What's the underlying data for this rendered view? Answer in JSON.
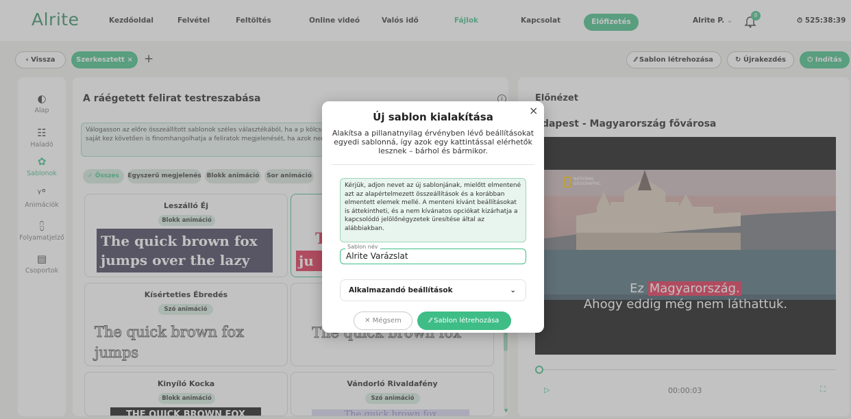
{
  "nav": {
    "logo": "Alrite",
    "items": [
      "Kezdőoldal",
      "Felvétel",
      "Feltöltés",
      "Online videó",
      "Valós idő",
      "Fájlok",
      "Kapcsolat"
    ],
    "subscribe": "Előfizetés",
    "user": "Alrite P.",
    "notifications": "8",
    "timer": "525:38:39"
  },
  "toolbar": {
    "back": "Vissza",
    "edited": "Szerkesztett",
    "create_template": "Sablon létrehozása",
    "restart": "Újrakezdés",
    "start": "Indítás"
  },
  "sidebar": [
    {
      "label": "Alap",
      "icon": "palette-icon"
    },
    {
      "label": "Haladó",
      "icon": "sliders-icon"
    },
    {
      "label": "Sablonok",
      "icon": "template-icon"
    },
    {
      "label": "Animációk",
      "icon": "motion-icon"
    },
    {
      "label": "Folyamatjelző",
      "icon": "progress-icon"
    },
    {
      "label": "Csoportok",
      "icon": "group-icon"
    }
  ],
  "main": {
    "title": "A ráégetett felirat testreszabása",
    "description": "Válogasson az előre összeállított sablonok széles választékából, ha a p kölcsönözni a feliratainak anélkül, hogy az egyes beállításokat saját kez követően is finomhangolhatja a feliratok megjelenését, ha azok nem fel",
    "filters": [
      "Összes",
      "Egyszerű megjelenés",
      "Blokk animáció",
      "Sor animáció"
    ],
    "cards": [
      {
        "title": "Leszálló Éj",
        "badge": "Blokk animáció",
        "sample": "The quick brown fox jumps over the lazy dog"
      },
      {
        "title": "Kísérteties Ébredés",
        "badge": "Szó animáció",
        "sample": "The quick brown fox jumps"
      },
      {
        "title": "Kinyíló Kocka",
        "badge": "Blokk animáció",
        "sample": "THE QUICK BROWN FOX"
      },
      {
        "title": "Vándorló Rivaldafény",
        "badge": "Szó animáció",
        "sample": "The quick brown fox"
      }
    ],
    "partial_card": {
      "sample_top": "T",
      "sample_bottom": "ju",
      "sample_second": "The quick brown fox"
    }
  },
  "preview": {
    "heading": "Előnézet",
    "title": "udapest - Magyarország fővárosa",
    "brand": "NATIONAL GEOGRAPHIC",
    "caption_pre": "Ez ",
    "caption_highlight": "Magyarország.",
    "caption_line2": "Ahogy eddig még nem láthattuk.",
    "time": "00:00:03",
    "progress": 0.0
  },
  "modal": {
    "title": "Új sablon kialakítása",
    "subtitle": "Alakítsa a pillanatnyilag érvényben lévő beállításokat egyedi sablonná, így azok egy kattintással elérhetők lesznek – bárhol és bármikor.",
    "note": "Kérjük, adjon nevet az új sablonjának, mielőtt elmentené azt az alapértelmezett összeállítások és a korábban elmentett elemek mellé. A menteni kívánt beállításokat is áttekintheti, és a nem kívánatos opciókat kizárhatja a kapcsolódó jelölőnégyzetek üresítése által az alábbiakban.",
    "field_label": "Sablon név",
    "field_value": "Alrite Varázslat",
    "accordion": "Alkalmazandó beállítások",
    "cancel": "Mégsem",
    "create": "Sablon létrehozása"
  },
  "colors": {
    "accent": "#3ebd86",
    "caption_highlight": "#e0284d"
  }
}
